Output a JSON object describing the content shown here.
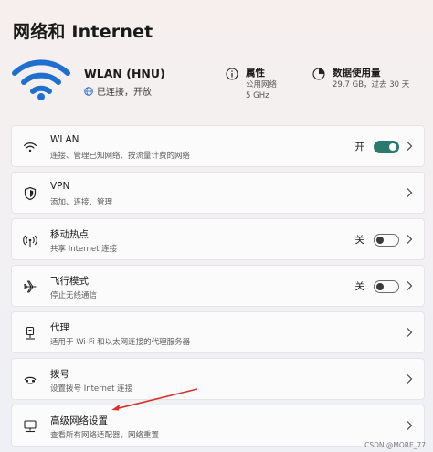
{
  "page": {
    "title": "网络和 Internet"
  },
  "connection": {
    "name": "WLAN (HNU)",
    "status": "已连接，开放",
    "icon": "wifi-icon"
  },
  "properties": {
    "title": "属性",
    "line1": "公用网络",
    "line2": "5 GHz",
    "icon": "info-icon"
  },
  "data_usage": {
    "title": "数据使用量",
    "value": "29.7 GB，过去 30 天",
    "icon": "data-usage-icon"
  },
  "items": [
    {
      "title": "WLAN",
      "desc": "连接、管理已知网络、按流量计费的网络",
      "icon": "wifi-icon",
      "toggle": "on",
      "toggle_label": "开"
    },
    {
      "title": "VPN",
      "desc": "添加、连接、管理",
      "icon": "shield-icon"
    },
    {
      "title": "移动热点",
      "desc": "共享 Internet 连接",
      "icon": "hotspot-icon",
      "toggle": "off",
      "toggle_label": "关"
    },
    {
      "title": "飞行模式",
      "desc": "停止无线通信",
      "icon": "airplane-icon",
      "toggle": "off",
      "toggle_label": "关"
    },
    {
      "title": "代理",
      "desc": "适用于 Wi-Fi 和以太网连接的代理服务器",
      "icon": "proxy-icon"
    },
    {
      "title": "拨号",
      "desc": "设置拨号 Internet 连接",
      "icon": "dialup-icon"
    },
    {
      "title": "高级网络设置",
      "desc": "查看所有网络适配器，网络重置",
      "icon": "network-adapter-icon"
    }
  ],
  "colors": {
    "accent": "#2a7a6e",
    "annotation": "#d9312b"
  },
  "watermark": "CSDN @MORE_77"
}
